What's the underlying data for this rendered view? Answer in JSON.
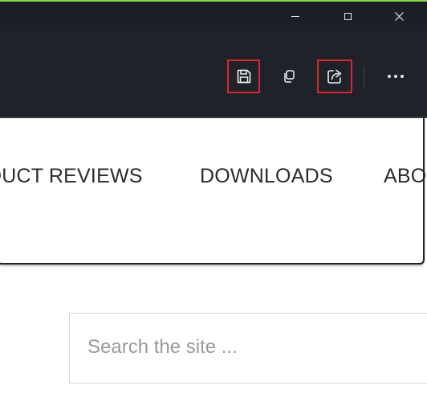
{
  "colors": {
    "accent_strip": "#8bd450",
    "chrome_background": "#1e2128",
    "highlight_border": "#d8262e",
    "icon_color": "#f0f0f0",
    "nav_text": "#2b2b2b",
    "placeholder_text": "#9a9a9a"
  },
  "window_controls": {
    "minimize_icon": "minimize-icon",
    "maximize_icon": "maximize-icon",
    "close_icon": "close-icon"
  },
  "toolbar": {
    "items": [
      {
        "icon": "save-icon",
        "highlighted": true
      },
      {
        "icon": "copy-icon",
        "highlighted": false
      },
      {
        "icon": "share-icon",
        "highlighted": true
      },
      {
        "icon": "more-icon",
        "highlighted": false
      }
    ]
  },
  "site_nav": {
    "items": [
      {
        "label": "DUCT REVIEWS"
      },
      {
        "label": "DOWNLOADS"
      },
      {
        "label": "ABO"
      }
    ]
  },
  "search": {
    "placeholder": "Search the site ..."
  }
}
